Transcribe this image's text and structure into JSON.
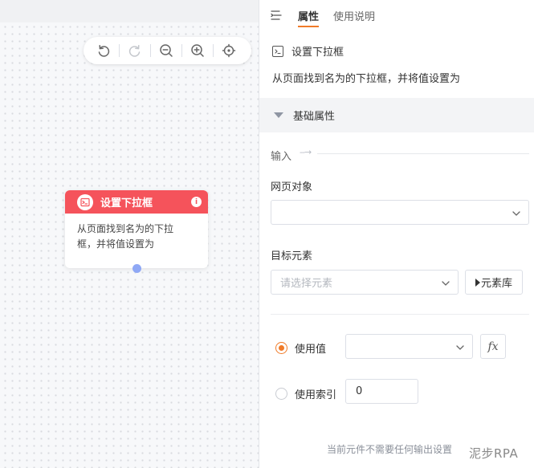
{
  "canvas": {
    "toolbar": {
      "undo_icon": "undo-icon",
      "redo_icon": "redo-icon",
      "zoom_out_icon": "zoom-out-icon",
      "zoom_in_icon": "zoom-in-icon",
      "locate_icon": "locate-icon"
    },
    "node": {
      "title": "设置下拉框",
      "description_line1": "从页面找到名为的下拉",
      "description_line2": "框，并将值设置为",
      "header_color": "#f5535b",
      "port_color": "#8fa8f5"
    }
  },
  "panel": {
    "tabs": [
      {
        "label": "属性",
        "active": true
      },
      {
        "label": "使用说明",
        "active": false
      }
    ],
    "component": {
      "title": "设置下拉框",
      "description": "从页面找到名为的下拉框，并将值设置为"
    },
    "section": {
      "title": "基础属性"
    },
    "input_heading": "输入",
    "fields": {
      "web_object": {
        "label": "网页对象",
        "value": ""
      },
      "target_element": {
        "label": "目标元素",
        "placeholder": "请选择元素",
        "library_button": "元素库"
      }
    },
    "options": {
      "use_value": {
        "label": "使用值",
        "checked": true,
        "value": ""
      },
      "fx_label": "fx",
      "use_index": {
        "label": "使用索引",
        "checked": false,
        "value": "0"
      }
    },
    "no_output_text": "当前元件不需要任何输出设置",
    "accent_color": "#f07b29"
  },
  "watermark": "泥步RPA"
}
